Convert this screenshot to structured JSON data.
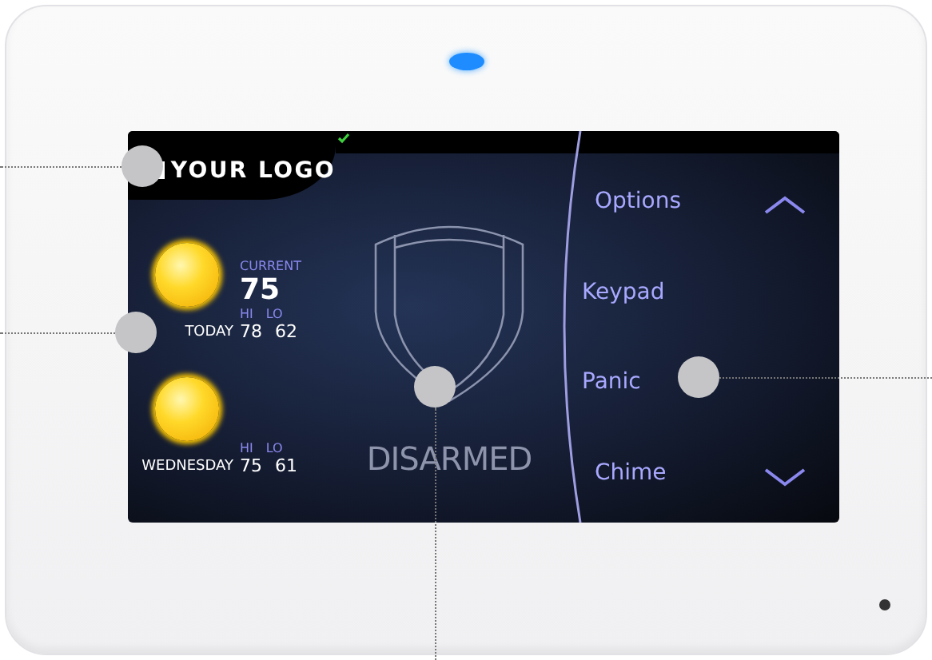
{
  "logo": "YOUR LOGO",
  "forecasts": [
    {
      "day": "TODAY",
      "current_label": "CURRENT",
      "current": "75",
      "hi_label": "HI",
      "lo_label": "LO",
      "hi": "78",
      "lo": "62"
    },
    {
      "day": "WEDNESDAY",
      "hi_label": "HI",
      "lo_label": "LO",
      "hi": "75",
      "lo": "61"
    }
  ],
  "status": "DISARMED",
  "menu": [
    {
      "label": "Options",
      "kind": "scroll-up"
    },
    {
      "label": "Keypad",
      "kind": "plain"
    },
    {
      "label": "Panic",
      "kind": "plain"
    },
    {
      "label": "Chime",
      "kind": "scroll-down"
    }
  ]
}
